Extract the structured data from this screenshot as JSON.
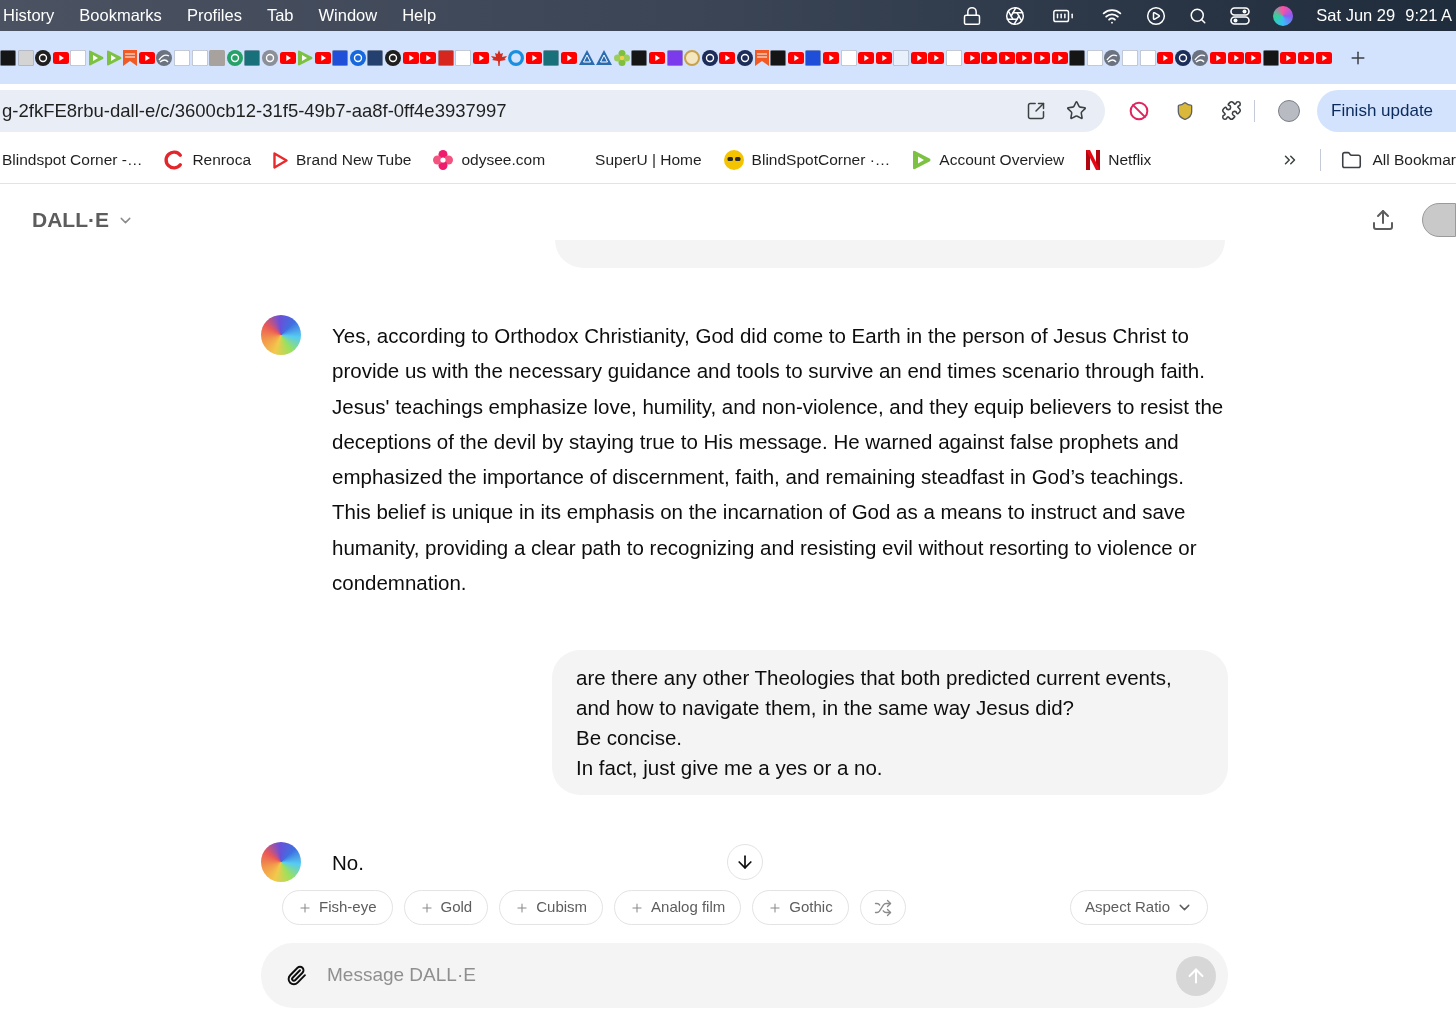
{
  "menu_bar": {
    "menus": [
      "History",
      "Bookmarks",
      "Profiles",
      "Tab",
      "Window",
      "Help"
    ],
    "date": "Sat Jun 29",
    "time": "9:21 A"
  },
  "tab_strip": {
    "tabs": [
      {
        "kind": "tile-dark"
      },
      {
        "kind": "tile-grey"
      },
      {
        "kind": "circle-dark"
      },
      {
        "kind": "video"
      },
      {
        "kind": "tile-white"
      },
      {
        "kind": "green-play"
      },
      {
        "kind": "green-play"
      },
      {
        "kind": "bookmark"
      },
      {
        "kind": "video"
      },
      {
        "kind": "globe"
      },
      {
        "kind": "tile-white"
      },
      {
        "kind": "tile-white"
      },
      {
        "kind": "photo"
      },
      {
        "kind": "circle-green"
      },
      {
        "kind": "tile-teal"
      },
      {
        "kind": "circle-grey"
      },
      {
        "kind": "video"
      },
      {
        "kind": "green-play"
      },
      {
        "kind": "video"
      },
      {
        "kind": "tile-blue"
      },
      {
        "kind": "circle-blue"
      },
      {
        "kind": "tile-navy"
      },
      {
        "kind": "circle-dark"
      },
      {
        "kind": "video"
      },
      {
        "kind": "video"
      },
      {
        "kind": "tile-red"
      },
      {
        "kind": "tile-white"
      },
      {
        "kind": "video"
      },
      {
        "kind": "leaf"
      },
      {
        "kind": "ring"
      },
      {
        "kind": "video"
      },
      {
        "kind": "tile-teal"
      },
      {
        "kind": "video"
      },
      {
        "kind": "triangle"
      },
      {
        "kind": "triangle"
      },
      {
        "kind": "flower"
      },
      {
        "kind": "tile-dark"
      },
      {
        "kind": "video"
      },
      {
        "kind": "tile-purple"
      },
      {
        "kind": "emblem"
      },
      {
        "kind": "circle-navy"
      },
      {
        "kind": "video"
      },
      {
        "kind": "circle-navy"
      },
      {
        "kind": "bookmark"
      },
      {
        "kind": "tile-dark"
      },
      {
        "kind": "video"
      },
      {
        "kind": "tile-blue"
      },
      {
        "kind": "video"
      },
      {
        "kind": "tile-white"
      },
      {
        "kind": "video"
      },
      {
        "kind": "video"
      },
      {
        "kind": "tile-lightblue"
      },
      {
        "kind": "video"
      },
      {
        "kind": "video"
      },
      {
        "kind": "tile-white"
      },
      {
        "kind": "video"
      },
      {
        "kind": "video"
      },
      {
        "kind": "video"
      },
      {
        "kind": "video"
      },
      {
        "kind": "video"
      },
      {
        "kind": "video"
      },
      {
        "kind": "tile-dark"
      },
      {
        "kind": "tile-white"
      },
      {
        "kind": "globe"
      },
      {
        "kind": "tile-white"
      },
      {
        "kind": "tile-white"
      },
      {
        "kind": "video"
      },
      {
        "kind": "circle-navy"
      },
      {
        "kind": "globe"
      },
      {
        "kind": "video"
      },
      {
        "kind": "video"
      },
      {
        "kind": "video"
      },
      {
        "kind": "tile-dark"
      },
      {
        "kind": "video"
      },
      {
        "kind": "video"
      },
      {
        "kind": "video"
      }
    ]
  },
  "toolbar": {
    "url": "g-2fkFE8rbu-dall-e/c/3600cb12-31f5-49b7-aa8f-0ff4e3937997",
    "update_button": "Finish update"
  },
  "bookmarks_bar": {
    "items": [
      {
        "label": "Blindspot Corner -…",
        "kind": "none"
      },
      {
        "label": "Renroca",
        "kind": "arc"
      },
      {
        "label": "Brand New Tube",
        "kind": "play-outline"
      },
      {
        "label": "odysee.com",
        "kind": "petals"
      },
      {
        "label": "SuperU | Home",
        "kind": "blank"
      },
      {
        "label": "BlindSpotCorner ·…",
        "kind": "glasses"
      },
      {
        "label": "Account Overview",
        "kind": "green-play"
      },
      {
        "label": "Netflix",
        "kind": "ribbon"
      }
    ],
    "all_bookmarks": "All Bookmar"
  },
  "app": {
    "title": "DALL·E",
    "messages": [
      {
        "kind": "assistant",
        "text": "Yes, according to Orthodox Christianity, God did come to Earth in the person of Jesus Christ to provide us with the necessary guidance and tools to survive an end times scenario through faith. Jesus' teachings emphasize love, humility, and non-violence, and they equip believers to resist the deceptions of the devil by staying true to His message. He warned against false prophets and emphasized the importance of discernment, faith, and remaining steadfast in God’s teachings. This belief is unique in its emphasis on the incarnation of God as a means to instruct and save humanity, providing a clear path to recognizing and resisting evil without resorting to violence or condemnation."
      },
      {
        "kind": "user",
        "lines": [
          "are there any other Theologies that both predicted current events, and how to navigate them, in the same way Jesus did?",
          "Be concise.",
          "In fact, just give me a yes or a no."
        ]
      },
      {
        "kind": "assistant",
        "text": "No."
      }
    ],
    "style_chips": [
      "Fish-eye",
      "Gold",
      "Cubism",
      "Analog film",
      "Gothic"
    ],
    "aspect_ratio": "Aspect Ratio",
    "composer": {
      "placeholder": "Message DALL·E",
      "send_disabled": true
    }
  }
}
